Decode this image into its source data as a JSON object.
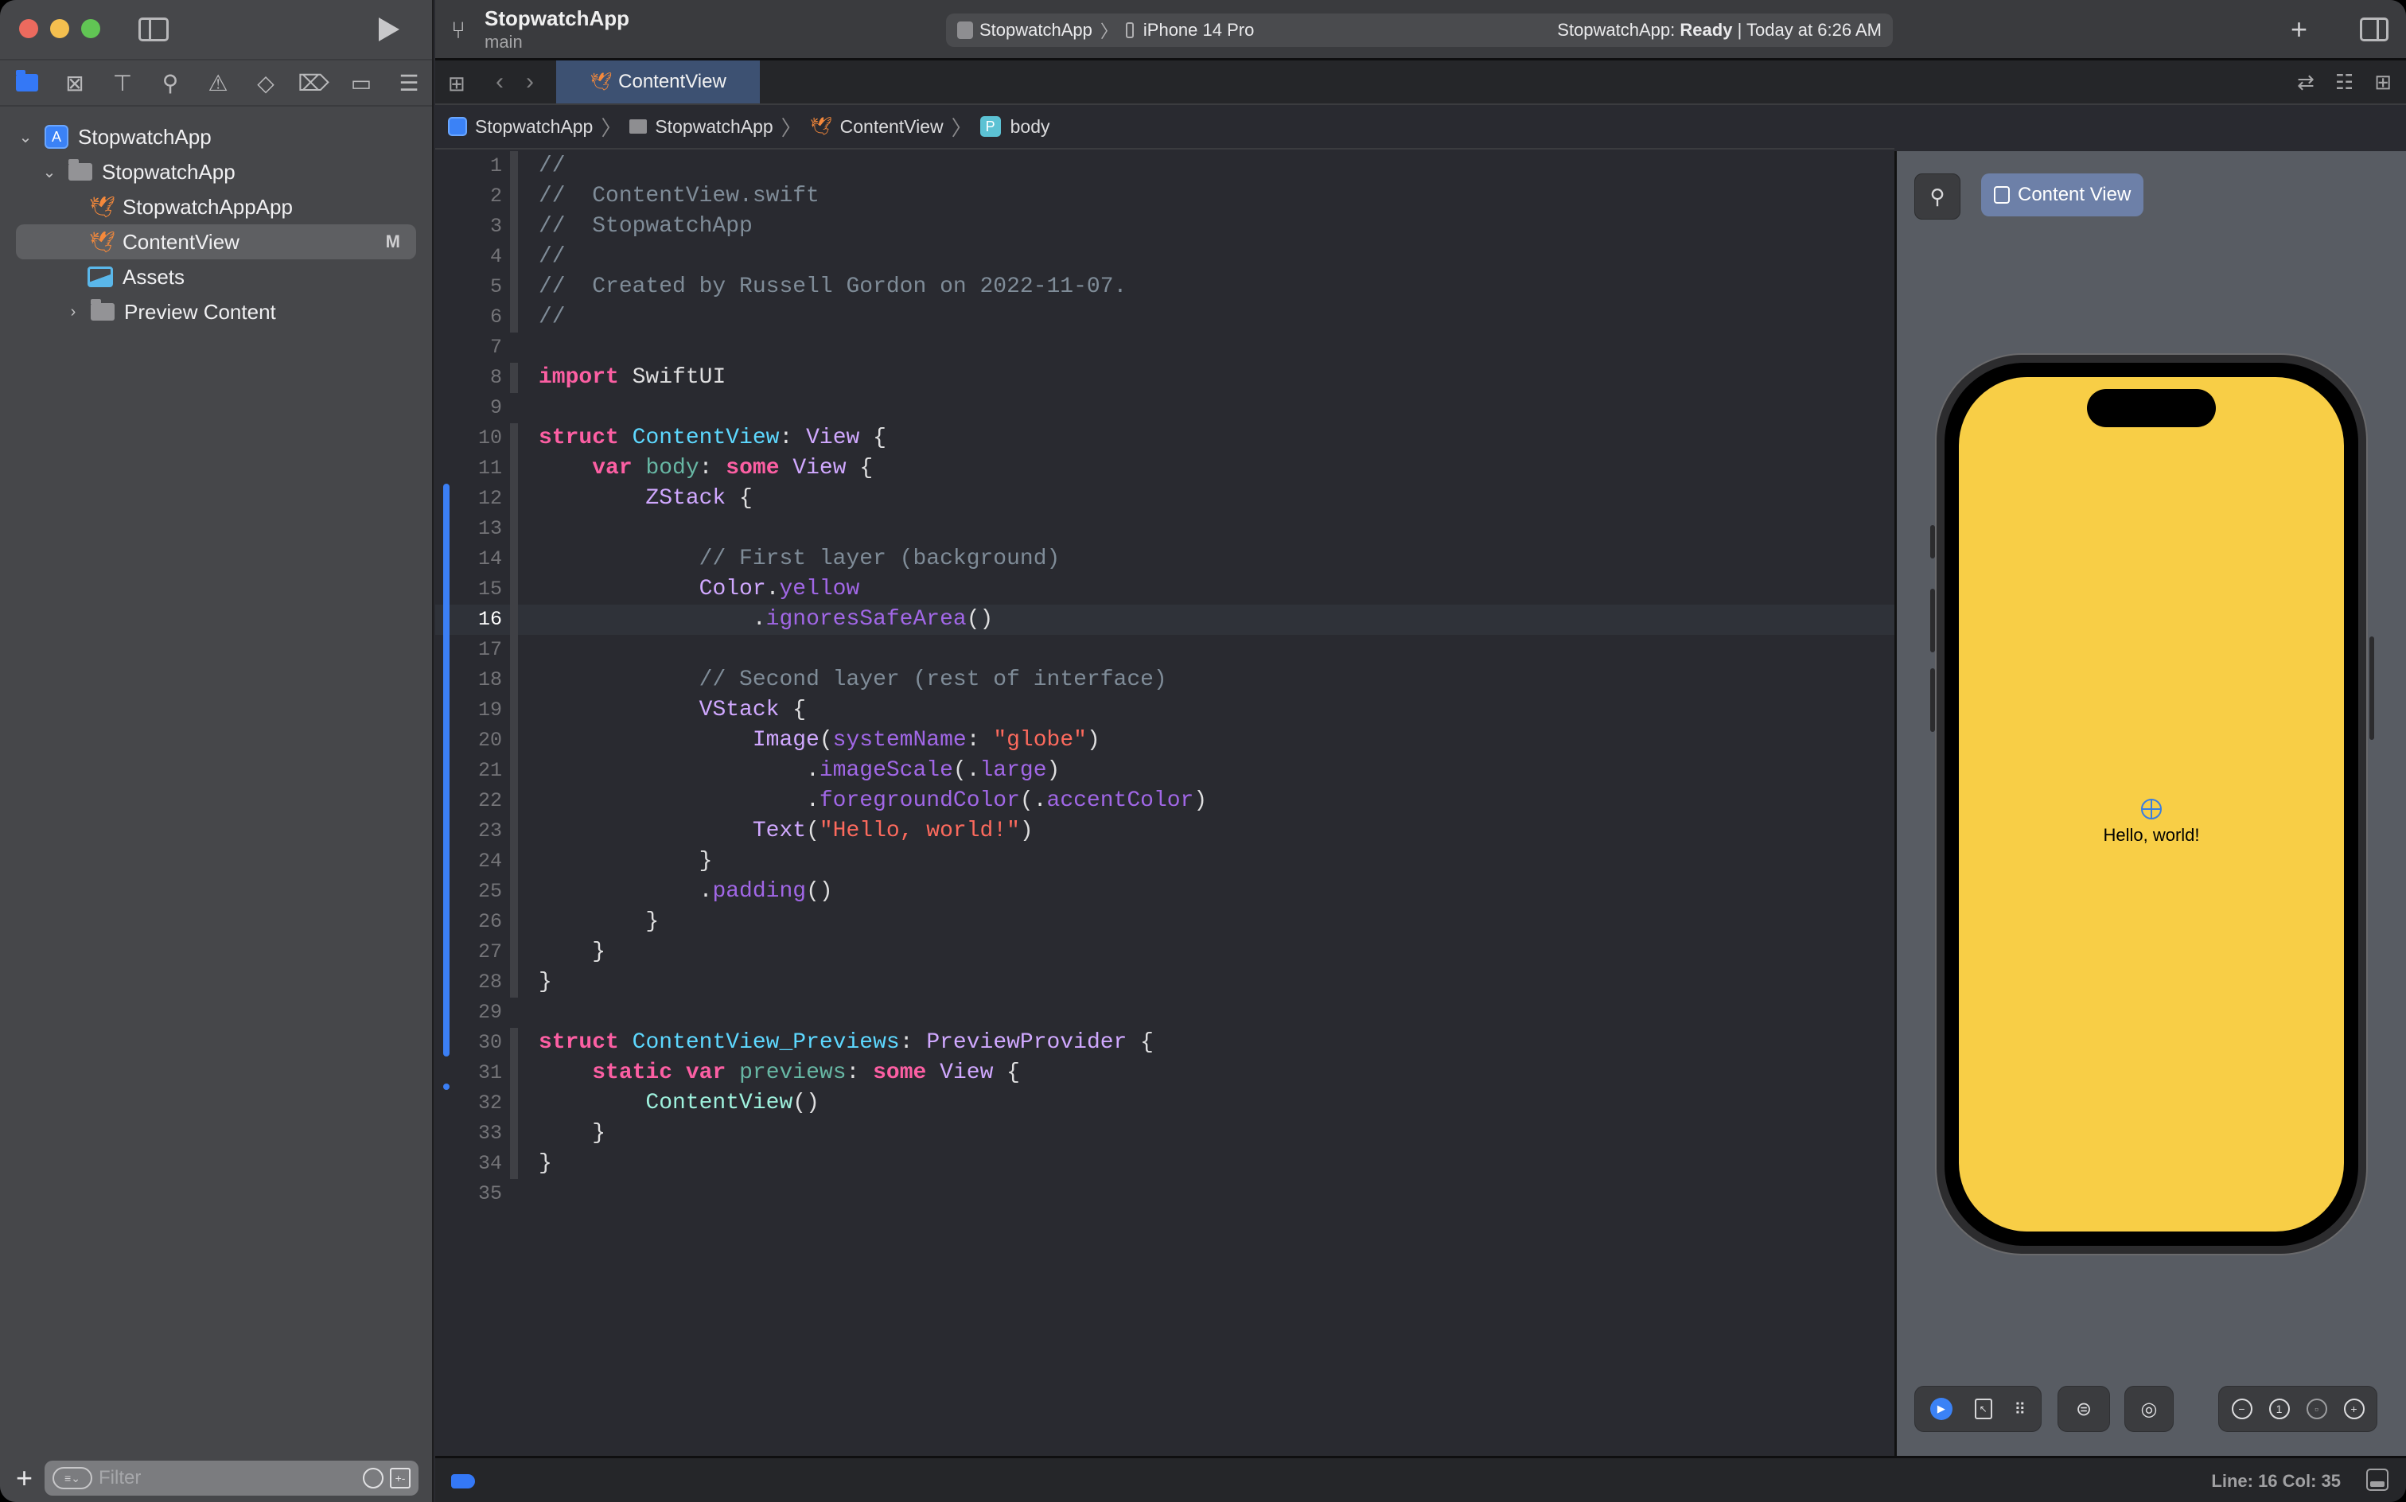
{
  "window": {
    "project_title": "StopwatchApp",
    "branch": "main"
  },
  "activity": {
    "scheme": "StopwatchApp",
    "device": "iPhone 14 Pro",
    "status_prefix": "StopwatchApp:",
    "status_state": "Ready",
    "status_time": "| Today at 6:26 AM"
  },
  "navigator": {
    "tabs": [
      "project-navigator",
      "source-control",
      "symbols",
      "find",
      "issues",
      "tests",
      "debug",
      "breakpoints",
      "reports"
    ],
    "tree": [
      {
        "label": "StopwatchApp",
        "kind": "project",
        "level": 0,
        "expanded": true
      },
      {
        "label": "StopwatchApp",
        "kind": "folder",
        "level": 1,
        "expanded": true
      },
      {
        "label": "StopwatchAppApp",
        "kind": "swift",
        "level": 2
      },
      {
        "label": "ContentView",
        "kind": "swift",
        "level": 2,
        "selected": true,
        "badge": "M"
      },
      {
        "label": "Assets",
        "kind": "assets",
        "level": 2
      },
      {
        "label": "Preview Content",
        "kind": "folder",
        "level": 2,
        "expanded": false
      }
    ],
    "filter_placeholder": "Filter"
  },
  "editor_tab": {
    "label": "ContentView"
  },
  "jumpbar": {
    "items": [
      "StopwatchApp",
      "StopwatchApp",
      "ContentView",
      "body"
    ],
    "prop_badge": "P"
  },
  "code": {
    "current_line": 16,
    "lines": [
      [
        [
          "c-cmt",
          "//"
        ]
      ],
      [
        [
          "c-cmt",
          "//  ContentView.swift"
        ]
      ],
      [
        [
          "c-cmt",
          "//  StopwatchApp"
        ]
      ],
      [
        [
          "c-cmt",
          "//"
        ]
      ],
      [
        [
          "c-cmt",
          "//  Created by Russell Gordon on 2022-11-07."
        ]
      ],
      [
        [
          "c-cmt",
          "//"
        ]
      ],
      [],
      [
        [
          "c-kw",
          "import"
        ],
        [
          "c-plain",
          " SwiftUI"
        ]
      ],
      [],
      [
        [
          "c-kw",
          "struct"
        ],
        [
          "c-plain",
          " "
        ],
        [
          "c-type",
          "ContentView"
        ],
        [
          "c-plain",
          ": "
        ],
        [
          "c-sys",
          "View"
        ],
        [
          "c-plain",
          " {"
        ]
      ],
      [
        [
          "c-plain",
          "    "
        ],
        [
          "c-kw",
          "var"
        ],
        [
          "c-plain",
          " "
        ],
        [
          "c-id",
          "body"
        ],
        [
          "c-plain",
          ": "
        ],
        [
          "c-kw",
          "some"
        ],
        [
          "c-plain",
          " "
        ],
        [
          "c-sys",
          "View"
        ],
        [
          "c-plain",
          " {"
        ]
      ],
      [
        [
          "c-plain",
          "        "
        ],
        [
          "c-sys",
          "ZStack"
        ],
        [
          "c-plain",
          " {"
        ]
      ],
      [],
      [
        [
          "c-plain",
          "            "
        ],
        [
          "c-cmt",
          "// First layer (background)"
        ]
      ],
      [
        [
          "c-plain",
          "            "
        ],
        [
          "c-sys",
          "Color"
        ],
        [
          "c-plain",
          "."
        ],
        [
          "c-meth",
          "yellow"
        ]
      ],
      [
        [
          "c-plain",
          "                ."
        ],
        [
          "c-meth",
          "ignoresSafeArea"
        ],
        [
          "c-plain",
          "()"
        ]
      ],
      [],
      [
        [
          "c-plain",
          "            "
        ],
        [
          "c-cmt",
          "// Second layer (rest of interface)"
        ]
      ],
      [
        [
          "c-plain",
          "            "
        ],
        [
          "c-sys",
          "VStack"
        ],
        [
          "c-plain",
          " {"
        ]
      ],
      [
        [
          "c-plain",
          "                "
        ],
        [
          "c-sys",
          "Image"
        ],
        [
          "c-plain",
          "("
        ],
        [
          "c-meth",
          "systemName"
        ],
        [
          "c-plain",
          ": "
        ],
        [
          "c-str",
          "\"globe\""
        ],
        [
          "c-plain",
          ")"
        ]
      ],
      [
        [
          "c-plain",
          "                    ."
        ],
        [
          "c-meth",
          "imageScale"
        ],
        [
          "c-plain",
          "(."
        ],
        [
          "c-meth",
          "large"
        ],
        [
          "c-plain",
          ")"
        ]
      ],
      [
        [
          "c-plain",
          "                    ."
        ],
        [
          "c-meth",
          "foregroundColor"
        ],
        [
          "c-plain",
          "(."
        ],
        [
          "c-meth",
          "accentColor"
        ],
        [
          "c-plain",
          ")"
        ]
      ],
      [
        [
          "c-plain",
          "                "
        ],
        [
          "c-sys",
          "Text"
        ],
        [
          "c-plain",
          "("
        ],
        [
          "c-str",
          "\"Hello, world!\""
        ],
        [
          "c-plain",
          ")"
        ]
      ],
      [
        [
          "c-plain",
          "            }"
        ]
      ],
      [
        [
          "c-plain",
          "            ."
        ],
        [
          "c-meth",
          "padding"
        ],
        [
          "c-plain",
          "()"
        ]
      ],
      [
        [
          "c-plain",
          "        }"
        ]
      ],
      [
        [
          "c-plain",
          "    }"
        ]
      ],
      [
        [
          "c-plain",
          "}"
        ]
      ],
      [],
      [
        [
          "c-kw",
          "struct"
        ],
        [
          "c-plain",
          " "
        ],
        [
          "c-type",
          "ContentView_Previews"
        ],
        [
          "c-plain",
          ": "
        ],
        [
          "c-sys",
          "PreviewProvider"
        ],
        [
          "c-plain",
          " {"
        ]
      ],
      [
        [
          "c-plain",
          "    "
        ],
        [
          "c-kw",
          "static"
        ],
        [
          "c-plain",
          " "
        ],
        [
          "c-kw",
          "var"
        ],
        [
          "c-plain",
          " "
        ],
        [
          "c-id",
          "previews"
        ],
        [
          "c-plain",
          ": "
        ],
        [
          "c-kw",
          "some"
        ],
        [
          "c-plain",
          " "
        ],
        [
          "c-sys",
          "View"
        ],
        [
          "c-plain",
          " {"
        ]
      ],
      [
        [
          "c-plain",
          "        "
        ],
        [
          "c-cls",
          "ContentView"
        ],
        [
          "c-plain",
          "()"
        ]
      ],
      [
        [
          "c-plain",
          "    }"
        ]
      ],
      [
        [
          "c-plain",
          "}"
        ]
      ],
      []
    ]
  },
  "canvas": {
    "preview_label": "Content View",
    "screen_color": "#f8ce46",
    "hello_text": "Hello, world!",
    "globe_color": "#3a7ee0"
  },
  "statusbar": {
    "position": "Line: 16  Col: 35"
  },
  "colors": {
    "accent": "#3b82f6",
    "swift_orange": "#f5893b"
  }
}
